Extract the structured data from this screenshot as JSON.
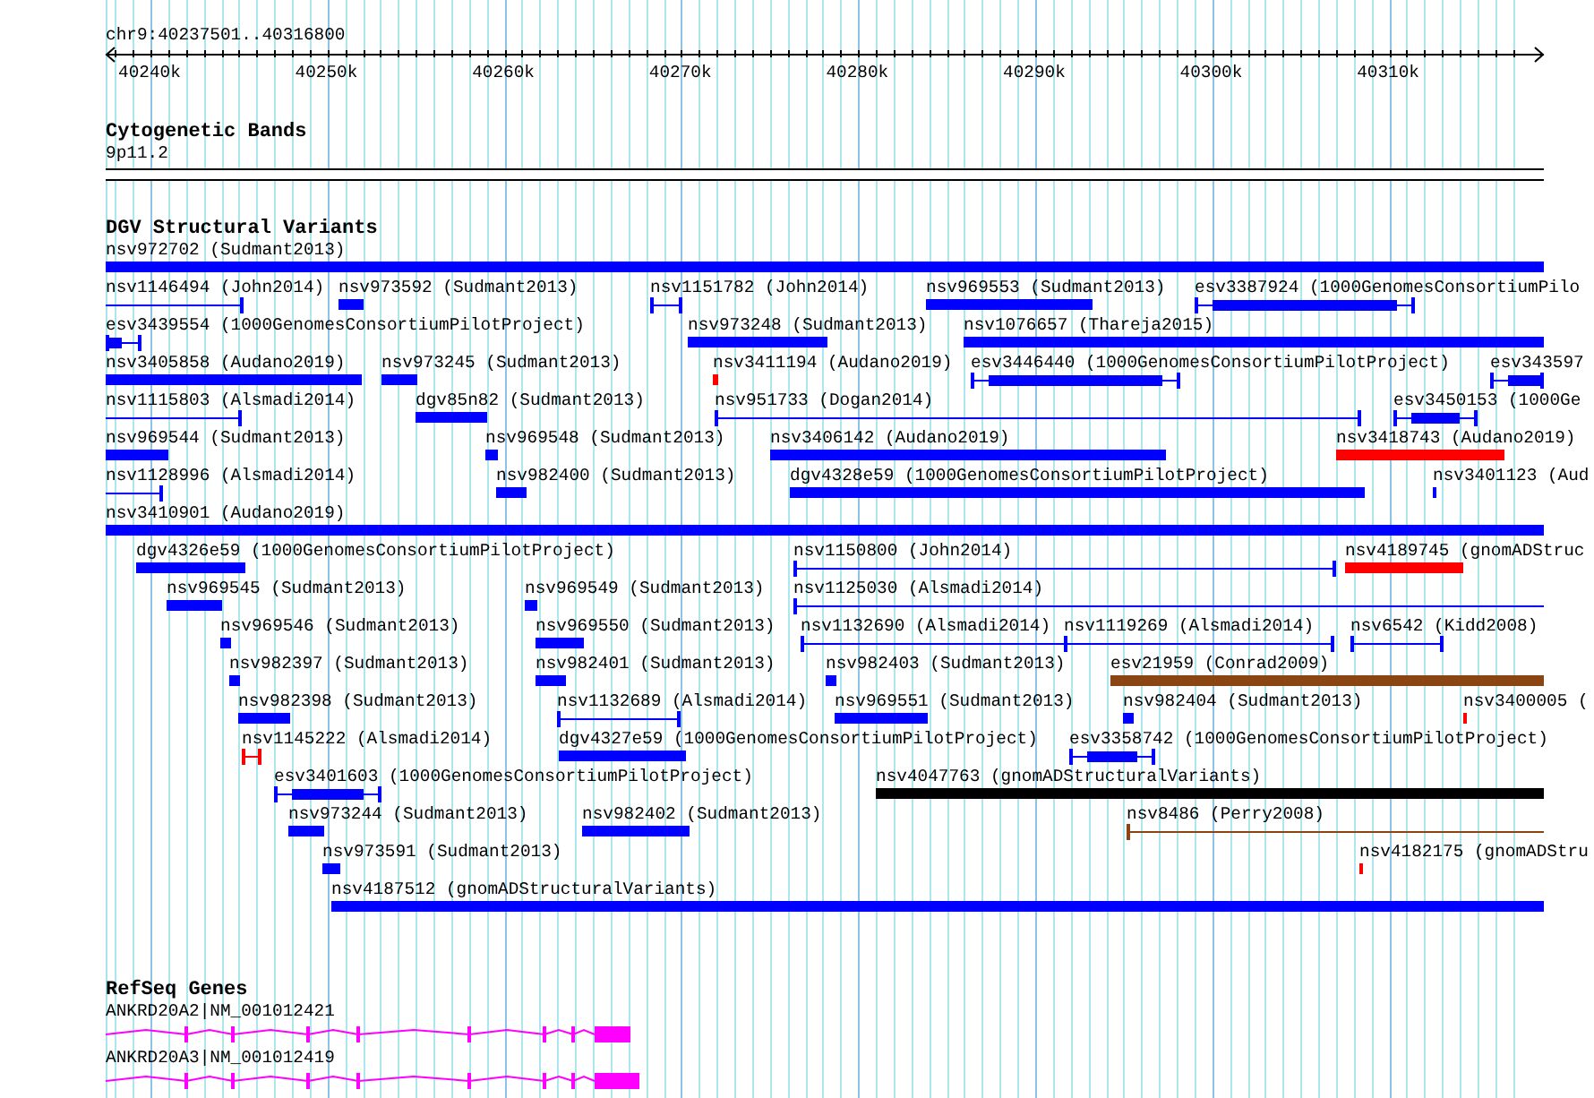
{
  "ruler": {
    "location": "chr9:40237501..40316800",
    "ticks": [
      "40240k",
      "40250k",
      "40260k",
      "40270k",
      "40280k",
      "40290k",
      "40300k",
      "40310k"
    ]
  },
  "tracks": [
    {
      "title": "Cytogenetic Bands",
      "kind": "bands",
      "bands": [
        {
          "name": "9p11.2"
        }
      ]
    },
    {
      "title": "DGV Structural Variants",
      "kind": "variants",
      "features": [
        {
          "label": "nsv972702 (Sudmant2013)",
          "kind": "block",
          "color": "#0000ff"
        },
        {
          "label": "nsv1146494 (John2014)",
          "kind": "span",
          "color": "#0000ff"
        },
        {
          "label": "nsv973592 (Sudmant2013)",
          "kind": "block",
          "color": "#0000ff"
        },
        {
          "label": "nsv1151782 (John2014)",
          "kind": "span",
          "color": "#0000ff"
        },
        {
          "label": "nsv969553 (Sudmant2013)",
          "kind": "block",
          "color": "#0000ff"
        },
        {
          "label": "esv3387924 (1000GenomesConsortiumPilo",
          "kind": "block_span",
          "color": "#0000ff"
        },
        {
          "label": "esv3439554 (1000GenomesConsortiumPilotProject)",
          "kind": "block_span",
          "color": "#0000ff"
        },
        {
          "label": "nsv973248 (Sudmant2013)",
          "kind": "block",
          "color": "#0000ff"
        },
        {
          "label": "nsv1076657 (Thareja2015)",
          "kind": "block",
          "color": "#0000ff"
        },
        {
          "label": "nsv3405858 (Audano2019)",
          "kind": "block",
          "color": "#0000ff"
        },
        {
          "label": "nsv973245 (Sudmant2013)",
          "kind": "block",
          "color": "#0000ff"
        },
        {
          "label": "nsv3411194 (Audano2019)",
          "kind": "block",
          "color": "#ff0000"
        },
        {
          "label": "esv3446440 (1000GenomesConsortiumPilotProject)",
          "kind": "block_span",
          "color": "#0000ff"
        },
        {
          "label": "esv343597",
          "kind": "block_span",
          "color": "#0000ff"
        },
        {
          "label": "nsv1115803 (Alsmadi2014)",
          "kind": "span",
          "color": "#0000ff"
        },
        {
          "label": "dgv85n82 (Sudmant2013)",
          "kind": "block",
          "color": "#0000ff"
        },
        {
          "label": "nsv951733 (Dogan2014)",
          "kind": "span",
          "color": "#0000ff"
        },
        {
          "label": "esv3450153 (1000Ge",
          "kind": "block_span",
          "color": "#0000ff"
        },
        {
          "label": "nsv969544 (Sudmant2013)",
          "kind": "block",
          "color": "#0000ff"
        },
        {
          "label": "nsv969548 (Sudmant2013)",
          "kind": "block",
          "color": "#0000ff"
        },
        {
          "label": "nsv3406142 (Audano2019)",
          "kind": "block",
          "color": "#0000ff"
        },
        {
          "label": "nsv3418743 (Audano2019)",
          "kind": "block",
          "color": "#ff0000"
        },
        {
          "label": "nsv1128996 (Alsmadi2014)",
          "kind": "span",
          "color": "#0000ff"
        },
        {
          "label": "nsv982400 (Sudmant2013)",
          "kind": "block",
          "color": "#0000ff"
        },
        {
          "label": "dgv4328e59 (1000GenomesConsortiumPilotProject)",
          "kind": "block",
          "color": "#0000ff"
        },
        {
          "label": "nsv3401123 (Aud",
          "kind": "block",
          "color": "#0000ff"
        },
        {
          "label": "nsv3410901 (Audano2019)",
          "kind": "block",
          "color": "#0000ff"
        },
        {
          "label": "dgv4326e59 (1000GenomesConsortiumPilotProject)",
          "kind": "block",
          "color": "#0000ff"
        },
        {
          "label": "nsv1150800 (John2014)",
          "kind": "span",
          "color": "#0000ff"
        },
        {
          "label": "nsv4189745 (gnomADStruc",
          "kind": "block",
          "color": "#ff0000"
        },
        {
          "label": "nsv969545 (Sudmant2013)",
          "kind": "block",
          "color": "#0000ff"
        },
        {
          "label": "nsv969549 (Sudmant2013)",
          "kind": "block",
          "color": "#0000ff"
        },
        {
          "label": "nsv1125030 (Alsmadi2014)",
          "kind": "span",
          "color": "#0000ff"
        },
        {
          "label": "nsv969546 (Sudmant2013)",
          "kind": "block",
          "color": "#0000ff"
        },
        {
          "label": "nsv969550 (Sudmant2013)",
          "kind": "block",
          "color": "#0000ff"
        },
        {
          "label": "nsv1132690 (Alsmadi2014)",
          "kind": "span",
          "color": "#0000ff"
        },
        {
          "label": "nsv1119269 (Alsmadi2014)",
          "kind": "span",
          "color": "#0000ff"
        },
        {
          "label": "nsv6542 (Kidd2008)",
          "kind": "span",
          "color": "#0000ff"
        },
        {
          "label": "nsv982397 (Sudmant2013)",
          "kind": "block",
          "color": "#0000ff"
        },
        {
          "label": "nsv982401 (Sudmant2013)",
          "kind": "block",
          "color": "#0000ff"
        },
        {
          "label": "nsv982403 (Sudmant2013)",
          "kind": "block",
          "color": "#0000ff"
        },
        {
          "label": "esv21959 (Conrad2009)",
          "kind": "block",
          "color": "#8b4513"
        },
        {
          "label": "nsv982398 (Sudmant2013)",
          "kind": "block",
          "color": "#0000ff"
        },
        {
          "label": "nsv1132689 (Alsmadi2014)",
          "kind": "span",
          "color": "#0000ff"
        },
        {
          "label": "nsv969551 (Sudmant2013)",
          "kind": "block",
          "color": "#0000ff"
        },
        {
          "label": "nsv982404 (Sudmant2013)",
          "kind": "block",
          "color": "#0000ff"
        },
        {
          "label": "nsv3400005 (",
          "kind": "block",
          "color": "#ff0000"
        },
        {
          "label": "nsv1145222 (Alsmadi2014)",
          "kind": "span",
          "color": "#ff0000"
        },
        {
          "label": "dgv4327e59 (1000GenomesConsortiumPilotProject)",
          "kind": "block",
          "color": "#0000ff"
        },
        {
          "label": "esv3358742 (1000GenomesConsortiumPilotProject)",
          "kind": "block_span",
          "color": "#0000ff"
        },
        {
          "label": "esv3401603 (1000GenomesConsortiumPilotProject)",
          "kind": "block_span",
          "color": "#0000ff"
        },
        {
          "label": "nsv4047763 (gnomADStructuralVariants)",
          "kind": "block",
          "color": "#000000"
        },
        {
          "label": "nsv973244 (Sudmant2013)",
          "kind": "block",
          "color": "#0000ff"
        },
        {
          "label": "nsv982402 (Sudmant2013)",
          "kind": "block",
          "color": "#0000ff"
        },
        {
          "label": "nsv8486 (Perry2008)",
          "kind": "span",
          "color": "#8b4513"
        },
        {
          "label": "nsv973591 (Sudmant2013)",
          "kind": "block",
          "color": "#0000ff"
        },
        {
          "label": "nsv4182175 (gnomADStru",
          "kind": "block",
          "color": "#ff0000"
        },
        {
          "label": "nsv4187512 (gnomADStructuralVariants)",
          "kind": "block",
          "color": "#0000ff"
        }
      ]
    },
    {
      "title": "RefSeq Genes",
      "kind": "genes",
      "genes": [
        {
          "label": "ANKRD20A2|NM_001012421"
        },
        {
          "label": "ANKRD20A3|NM_001012419"
        }
      ]
    }
  ]
}
